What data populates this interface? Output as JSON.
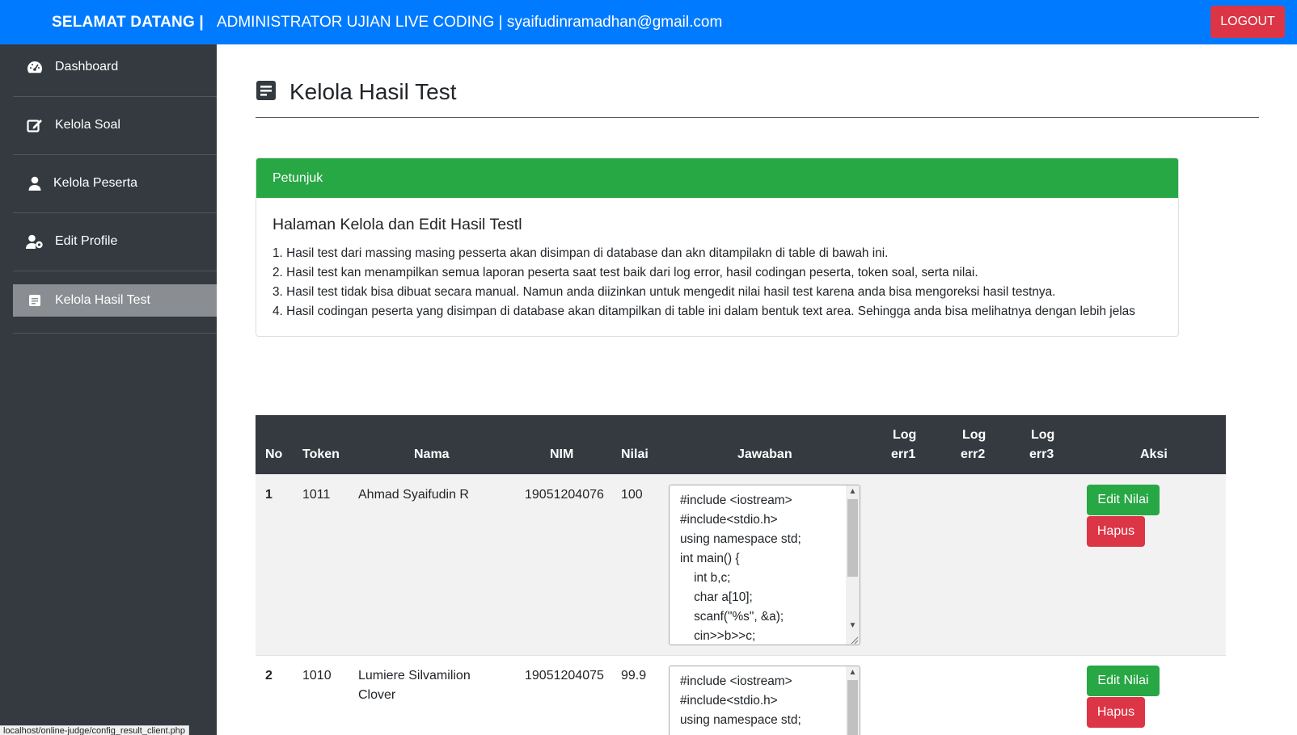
{
  "header": {
    "welcome": "SELAMAT DATANG |",
    "admin_info": "ADMINISTRATOR UJIAN LIVE CODING | syaifudinramadhan@gmail.com",
    "logout_label": "LOGOUT",
    "brand_color": "#007bff"
  },
  "sidebar": {
    "items": [
      {
        "label": "Dashboard",
        "icon": "tachometer-icon"
      },
      {
        "label": "Kelola Soal",
        "icon": "edit-icon"
      },
      {
        "label": "Kelola Peserta",
        "icon": "user-icon"
      },
      {
        "label": "Edit Profile",
        "icon": "user-cog-icon"
      },
      {
        "label": "Kelola Hasil Test",
        "icon": "file-alt-icon",
        "active": true
      }
    ]
  },
  "page": {
    "title": "Kelola Hasil Test",
    "title_icon": "file-alt-icon"
  },
  "instructions": {
    "header": "Petunjuk",
    "heading": "Halaman Kelola dan Edit Hasil Testl",
    "lines": [
      "1. Hasil test dari massing masing pesserta akan disimpan di database dan akn ditampilakn di table di bawah ini.",
      "2. Hasil test kan menampilkan semua laporan peserta saat test baik dari log error, hasil codingan peserta, token soal, serta nilai.",
      "3. Hasil test tidak bisa dibuat secara manual. Namun anda diizinkan untuk mengedit nilai hasil test karena anda bisa mengoreksi hasil testnya.",
      "4. Hasil codingan peserta yang disimpan di database akan ditampilkan di table ini dalam bentuk text area. Sehingga anda bisa melihatnya dengan lebih jelas"
    ]
  },
  "table": {
    "columns": {
      "no": "No",
      "token": "Token",
      "nama": "Nama",
      "nim": "NIM",
      "nilai": "Nilai",
      "jawaban": "Jawaban",
      "log1_a": "Log",
      "log1_b": "err1",
      "log2_a": "Log",
      "log2_b": "err2",
      "log3_a": "Log",
      "log3_b": "err3",
      "aksi": "Aksi"
    },
    "rows": [
      {
        "no": "1",
        "token": "1011",
        "nama": "Ahmad Syaifudin R",
        "nim": "19051204076",
        "nilai": "100",
        "jawaban": "#include <iostream>\n#include<stdio.h>\nusing namespace std;\nint main() {\n    int b,c;\n    char a[10];\n    scanf(\"%s\", &a);\n    cin>>b>>c;",
        "log_err1": "",
        "log_err2": "",
        "log_err3": "",
        "edit_label": "Edit Nilai",
        "delete_label": "Hapus"
      },
      {
        "no": "2",
        "token": "1010",
        "nama": "Lumiere Silvamilion Clover",
        "nim": "19051204075",
        "nilai": "99.9",
        "jawaban": "#include <iostream>\n#include<stdio.h>\nusing namespace std;",
        "log_err1": "",
        "log_err2": "",
        "log_err3": "",
        "edit_label": "Edit Nilai",
        "delete_label": "Hapus"
      }
    ]
  },
  "status_bar": {
    "url": "localhost/online-judge/config_result_client.php"
  }
}
